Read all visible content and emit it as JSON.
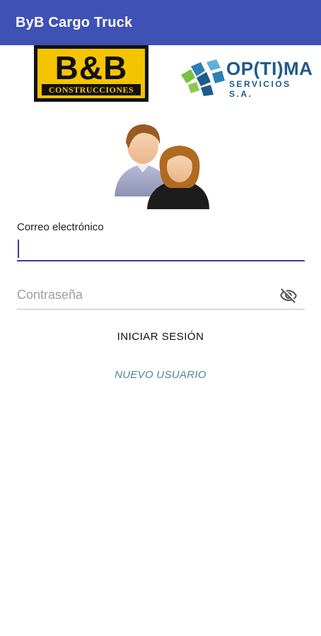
{
  "app_bar": {
    "title": "ByB Cargo Truck",
    "color": "#3f51b5"
  },
  "logos": {
    "bb": {
      "main": "B&B",
      "sub": "CONSTRUCCIONES"
    },
    "optima": {
      "name": "OP(TI)MA",
      "tagline": "SERVICIOS S.A."
    }
  },
  "illustration": {
    "icon": "users-icon"
  },
  "form": {
    "email_label": "Correo electrónico",
    "email_value": "",
    "password_placeholder": "Contraseña",
    "password_value": "",
    "visibility_icon": "visibility-off-icon"
  },
  "actions": {
    "login_label": "INICIAR SESIÓN",
    "new_user_label": "NUEVO USUARIO"
  },
  "colors": {
    "accent": "#3f3aa0",
    "link": "#4d8a86",
    "bb_yellow": "#f5c400",
    "optima_blue": "#1d5b8c"
  }
}
